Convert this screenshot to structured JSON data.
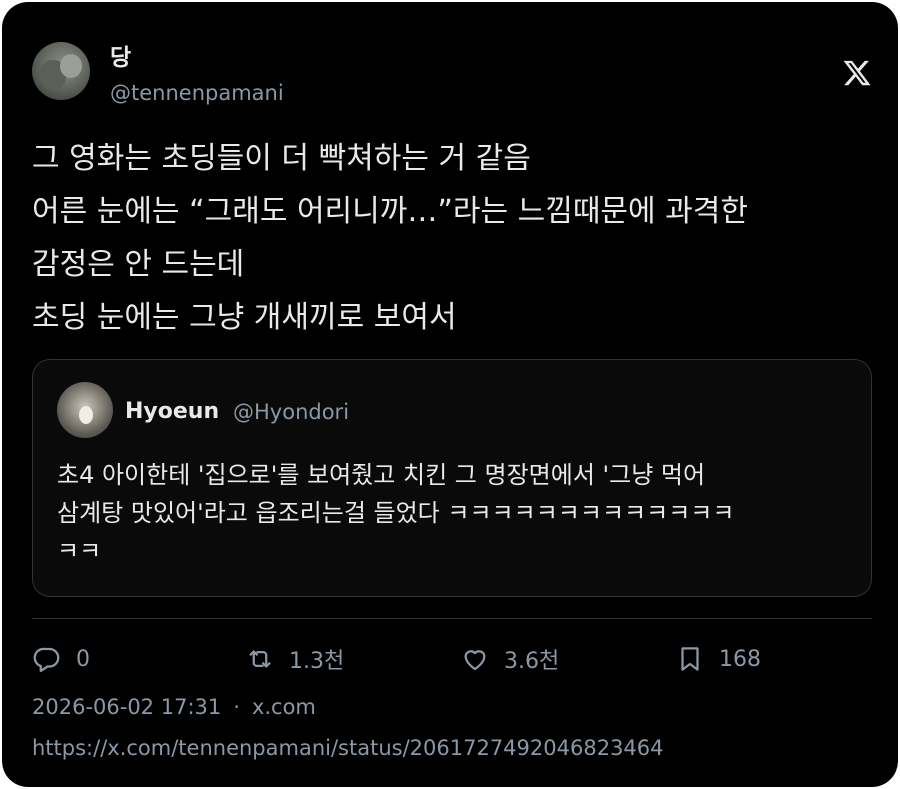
{
  "author": {
    "display_name": "당",
    "handle": "@tennenpamani"
  },
  "platform_logo": "x-logo-icon",
  "tweet": {
    "lines": [
      "그 영화는 초딩들이 더 빡쳐하는 거 같음",
      "어른 눈에는 “그래도 어리니까…”라는 느낌때문에 과격한",
      "감정은 안 드는데",
      "초딩 눈에는 그냥 개새끼로 보여서"
    ]
  },
  "quoted": {
    "display_name": "Hyoeun",
    "handle": "@Hyondori",
    "lines": [
      "초4 아이한테 '집으로'를 보여줬고 치킨 그 명장면에서 '그냥 먹어",
      "삼계탕 맛있어'라고 읍조리는걸 들었다 ㅋㅋㅋㅋㅋㅋㅋㅋㅋㅋㅋㅋㅋ",
      "ㅋㅋ"
    ]
  },
  "actions": {
    "reply": {
      "icon": "reply-icon",
      "count": "0"
    },
    "retweet": {
      "icon": "retweet-icon",
      "count": "1.3천"
    },
    "like": {
      "icon": "heart-icon",
      "count": "3.6천"
    },
    "bookmark": {
      "icon": "bookmark-icon",
      "count": "168"
    }
  },
  "meta": {
    "timestamp": "2026-06-02 17:31",
    "separator": "·",
    "source": "x.com"
  },
  "url": "https://x.com/tennenpamani/status/2061727492046823464",
  "colors": {
    "background": "#000000",
    "text": "#e7e9ea",
    "secondary": "#8b98a5",
    "border": "#2f3336"
  }
}
